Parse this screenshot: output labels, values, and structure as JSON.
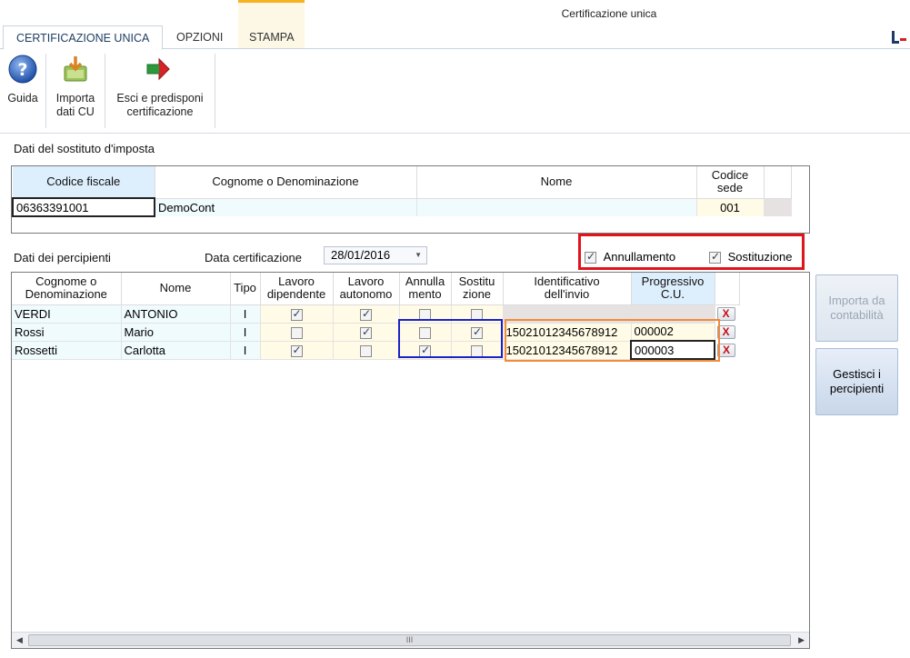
{
  "window": {
    "title": "Certificazione unica"
  },
  "tabs": [
    {
      "label": "CERTIFICAZIONE UNICA"
    },
    {
      "label": "OPZIONI"
    },
    {
      "label": "STAMPA"
    }
  ],
  "ribbon": {
    "guida": {
      "label": "Guida",
      "icon": "help-icon"
    },
    "importa": {
      "label_line1": "Importa",
      "label_line2": "dati CU",
      "icon": "import-icon"
    },
    "esci": {
      "label_line1": "Esci e predisponi",
      "label_line2": "certificazione",
      "icon": "arrow-exit-icon"
    }
  },
  "sostituto": {
    "section_label": "Dati del sostituto d'imposta",
    "headers": {
      "codice_fiscale": "Codice fiscale",
      "cognome": "Cognome o Denominazione",
      "nome": "Nome",
      "codice_sede_1": "Codice",
      "codice_sede_2": "sede"
    },
    "row": {
      "codice_fiscale": "06363391001",
      "cognome": "DemoCont",
      "nome": "",
      "codice_sede": "001"
    }
  },
  "percipienti": {
    "section_label": "Dati dei percipienti",
    "data_cert_label": "Data certificazione",
    "data_cert_value": "28/01/2016",
    "annullamento_label": "Annullamento",
    "annullamento_checked": true,
    "sostituzione_label": "Sostituzione",
    "sostituzione_checked": true,
    "headers": {
      "cognome_1": "Cognome o",
      "cognome_2": "Denominazione",
      "nome": "Nome",
      "tipo": "Tipo",
      "lavdip_1": "Lavoro",
      "lavdip_2": "dipendente",
      "lavaut_1": "Lavoro",
      "lavaut_2": "autonomo",
      "annulla_1": "Annulla",
      "annulla_2": "mento",
      "sostitu_1": "Sostitu",
      "sostitu_2": "zione",
      "ident_1": "Identificativo",
      "ident_2": "dell'invio",
      "prog_1": "Progressivo",
      "prog_2": "C.U."
    },
    "rows": [
      {
        "cognome": "VERDI",
        "nome": "ANTONIO",
        "tipo": "I",
        "lav_dip": true,
        "lav_aut": true,
        "annullamento": false,
        "sostituzione": false,
        "identificativo": "",
        "progressivo": ""
      },
      {
        "cognome": "Rossi",
        "nome": "Mario",
        "tipo": "I",
        "lav_dip": false,
        "lav_aut": true,
        "annullamento": false,
        "sostituzione": true,
        "identificativo": "15021012345678912",
        "progressivo": "000002"
      },
      {
        "cognome": "Rossetti",
        "nome": "Carlotta",
        "tipo": "I",
        "lav_dip": true,
        "lav_aut": false,
        "annullamento": true,
        "sostituzione": false,
        "identificativo": "15021012345678912",
        "progressivo": "000003"
      }
    ],
    "delete_label": "X"
  },
  "side_buttons": {
    "importa_contabilita_1": "Importa da",
    "importa_contabilita_2": "contabilità",
    "gestisci_1": "Gestisci i",
    "gestisci_2": "percipienti"
  },
  "scrollbar": {
    "thumb_grip": "III"
  }
}
